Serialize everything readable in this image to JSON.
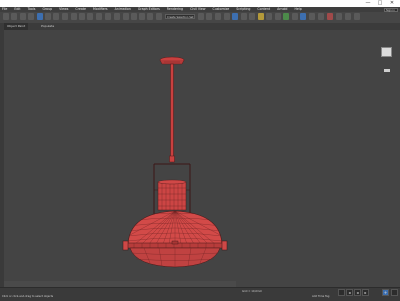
{
  "app": {
    "titlebar_controls": [
      "—",
      "□",
      "✕"
    ]
  },
  "menu": {
    "items": [
      "File",
      "Edit",
      "Tools",
      "Group",
      "Views",
      "Create",
      "Modifiers",
      "Animation",
      "Graph Editors",
      "Rendering",
      "Civil View",
      "Customize",
      "Scripting",
      "Content",
      "Arnold",
      "Help"
    ],
    "search_placeholder": "Sign in"
  },
  "toolbar": {
    "selection_set_placeholder": "Create Selection Set"
  },
  "ribbon": {
    "tabs": [
      "Object Paint",
      "Populate"
    ]
  },
  "status": {
    "message": "Click or click-and-drag to select objects",
    "grid": "Grid = 10,0mm",
    "time_tag": "Add Time Tag"
  },
  "icons": {
    "colors": {
      "wire": "#e84848",
      "accent": "#3d6fb0"
    }
  }
}
